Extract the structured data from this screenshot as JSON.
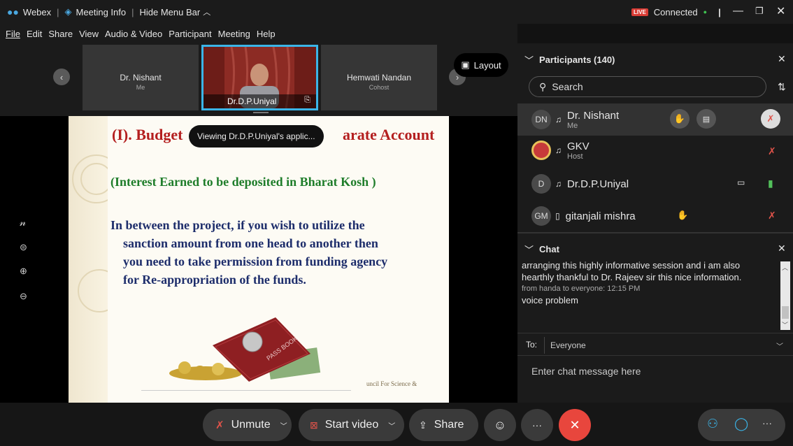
{
  "titlebar": {
    "app": "Webex",
    "meeting_info": "Meeting Info",
    "hide_menu": "Hide Menu Bar",
    "live": "LIVE",
    "connected": "Connected"
  },
  "menu": [
    "File",
    "Edit",
    "Share",
    "View",
    "Audio & Video",
    "Participant",
    "Meeting",
    "Help"
  ],
  "filmstrip": {
    "tiles": [
      {
        "name": "Dr. Nishant",
        "sub": "Me"
      },
      {
        "name": "Dr.D.P.Uniyal",
        "sub": ""
      },
      {
        "name": "Hemwati Nandan",
        "sub": "Cohost"
      }
    ],
    "layout_label": "Layout"
  },
  "stage": {
    "viewing_tooltip": "Viewing Dr.D.P.Uniyal's applic...",
    "slide": {
      "title_left": "(I). Budget",
      "title_right": "arate Account",
      "subtitle": "(Interest Earned to be deposited in Bharat Kosh )",
      "body": [
        "In between the project, if you wish to utilize the",
        "sanction amount from one head to another then",
        "you need to take permission from funding agency",
        "for Re-appropriation of the funds."
      ],
      "footer": "uncil For Science &",
      "passbook": "PASS BOOK"
    }
  },
  "participants": {
    "header": "Participants (140)",
    "search_placeholder": "Search",
    "list": [
      {
        "initials": "DN",
        "name": "Dr. Nishant",
        "role": "Me"
      },
      {
        "initials": "",
        "name": "GKV",
        "role": "Host"
      },
      {
        "initials": "D",
        "name": "Dr.D.P.Uniyal",
        "role": ""
      },
      {
        "initials": "GM",
        "name": "gitanjali mishra",
        "role": ""
      }
    ]
  },
  "chat": {
    "header": "Chat",
    "messages": [
      "arranging this highly informative session  and i am also",
      "hearthly thankful to Dr. Rajeev  sir this nice information."
    ],
    "meta": "from handa to everyone:   12:15 PM",
    "last": "voice problem",
    "to_label": "To:",
    "to_value": "Everyone",
    "input_placeholder": "Enter chat message here"
  },
  "controls": {
    "unmute": "Unmute",
    "start_video": "Start video",
    "share": "Share",
    "more": "···",
    "end": "✕"
  },
  "colors": {
    "accent_blue": "#3bb5e8",
    "end_red": "#e8463d",
    "mute_red": "#e0534a",
    "live_red": "#d93c35",
    "slide_red": "#b41f1f",
    "slide_green": "#1f7d2a",
    "slide_navy": "#1d2d6b"
  }
}
